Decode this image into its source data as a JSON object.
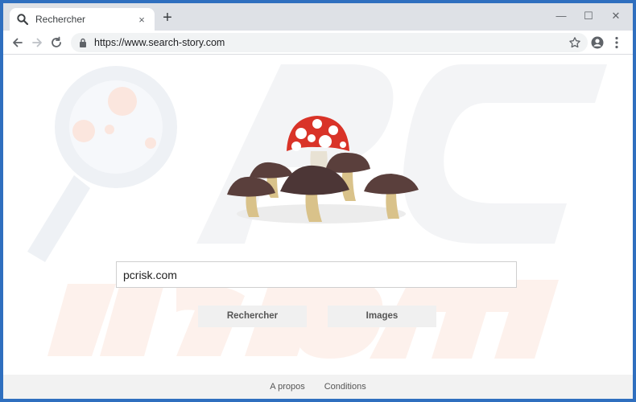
{
  "browser": {
    "tab": {
      "title": "Rechercher",
      "favicon": "search-icon",
      "close": "×"
    },
    "new_tab": "+",
    "window_controls": {
      "minimize": "—",
      "maximize": "☐",
      "close": "✕"
    },
    "toolbar": {
      "url": "https://www.search-story.com",
      "icons": [
        "back-icon",
        "forward-icon",
        "reload-icon",
        "lock-icon",
        "star-icon",
        "account-icon",
        "menu-icon"
      ]
    }
  },
  "page": {
    "hero_image": "mushroom-illustration",
    "search": {
      "value": "pcrisk.com",
      "placeholder": ""
    },
    "buttons": {
      "search": "Rechercher",
      "images": "Images"
    },
    "footer": {
      "about": "A propos",
      "terms": "Conditions"
    }
  },
  "colors": {
    "window_border": "#2f6fbf",
    "tab_bar": "#dee1e6",
    "omnibox": "#f1f3f4",
    "button_bg": "#f0f0f0",
    "footer_bg": "#f2f2f2"
  }
}
